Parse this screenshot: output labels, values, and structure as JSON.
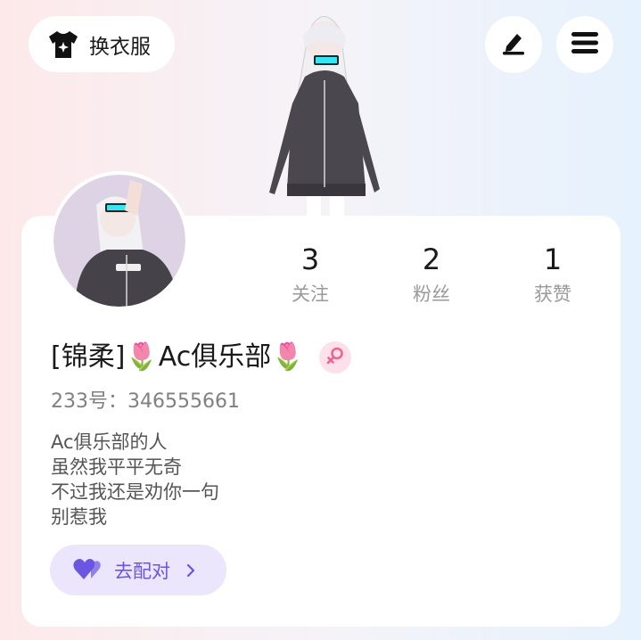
{
  "top_bar": {
    "outfit_label": "换衣服",
    "outfit_icon": "tshirt-sparkle-icon",
    "edit_icon": "pen-icon",
    "menu_icon": "hamburger-menu-icon"
  },
  "profile": {
    "stats": [
      {
        "value": "3",
        "label": "关注"
      },
      {
        "value": "2",
        "label": "粉丝"
      },
      {
        "value": "1",
        "label": "获赞"
      }
    ],
    "name": "[锦柔]🌷Ac俱乐部🌷",
    "gender_icon": "female-symbol-icon",
    "uid": "233号：346555661",
    "bio": [
      "Ac俱乐部的人",
      "虽然我平平无奇",
      "不过我还是劝你一句",
      "别惹我"
    ],
    "match_label": "去配对",
    "match_icon": "heart-pair-icon"
  },
  "colors": {
    "accent": "#6a56e0",
    "match_bg": "#ebe6fc",
    "gender_bg": "#fde0ea",
    "gender_fg": "#f06292"
  }
}
